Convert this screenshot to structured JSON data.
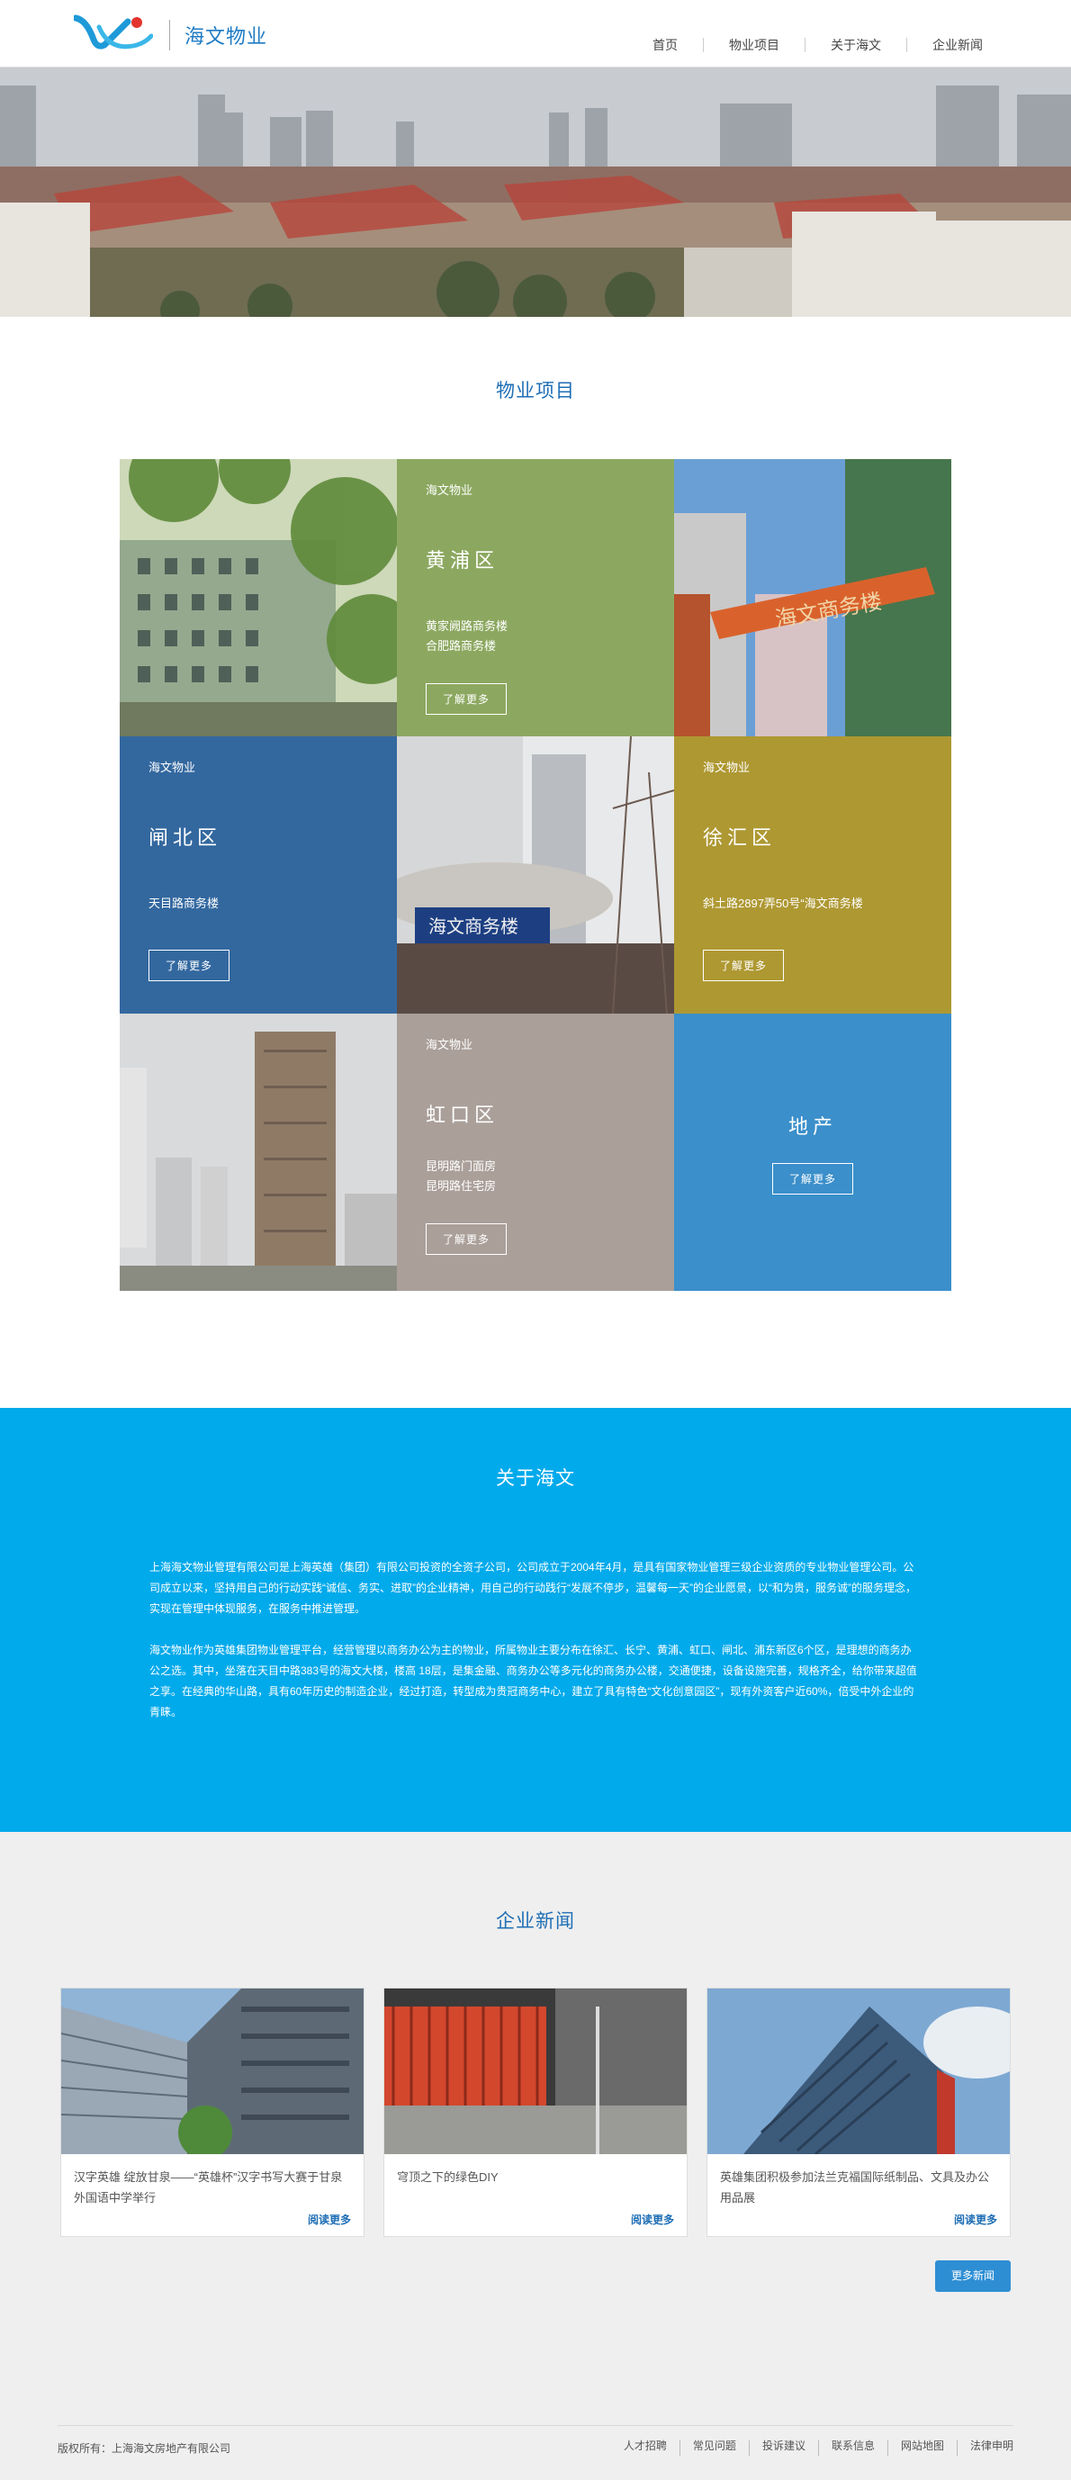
{
  "header": {
    "logo_text": "海文物业",
    "nav": [
      "首页",
      "物业项目",
      "关于海文",
      "企业新闻"
    ]
  },
  "projects": {
    "title": "物业项目",
    "tiles": {
      "huangpu": {
        "brand": "海文物业",
        "district": "黄浦区",
        "lines": [
          "黄家阙路商务楼",
          "合肥路商务楼"
        ],
        "button": "了解更多"
      },
      "zhabei": {
        "brand": "海文物业",
        "district": "闸北区",
        "lines": [
          "天目路商务楼"
        ],
        "button": "了解更多"
      },
      "xuhui": {
        "brand": "海文物业",
        "district": "徐汇区",
        "lines": [
          "斜土路2897弄50号“海文商务楼"
        ],
        "button": "了解更多"
      },
      "hongkou": {
        "brand": "海文物业",
        "district": "虹口区",
        "lines": [
          "昆明路门面房",
          "昆明路住宅房"
        ],
        "button": "了解更多"
      },
      "realestate": {
        "district": "地产",
        "button": "了解更多"
      }
    },
    "photo_signs": {
      "arch_sign": "海文商务楼",
      "building_sign": "海文商务楼"
    }
  },
  "about": {
    "title": "关于海文",
    "paragraphs": [
      "上海海文物业管理有限公司是上海英雄（集团）有限公司投资的全资子公司，公司成立于2004年4月，是具有国家物业管理三级企业资质的专业物业管理公司。公司成立以来，坚持用自己的行动实践“诚信、务实、进取”的企业精神，用自己的行动践行“发展不停步，温馨每一天”的企业愿景，以“和为贵，服务诚”的服务理念，实现在管理中体现服务，在服务中推进管理。",
      "海文物业作为英雄集团物业管理平台，经营管理以商务办公为主的物业，所属物业主要分布在徐汇、长宁、黄浦、虹口、闸北、浦东新区6个区，是理想的商务办公之选。其中，坐落在天目中路383号的海文大楼，楼高 18层，是集金融、商务办公等多元化的商务办公楼，交通便捷，设备设施完善，规格齐全，给你带来超值之享。在经典的华山路，具有60年历史的制造企业，经过打造，转型成为贵冠商务中心，建立了具有特色“文化创意园区”，现有外资客户近60%，倍受中外企业的青睐。"
    ]
  },
  "news": {
    "title": "企业新闻",
    "items": [
      {
        "title": "汉字英雄 绽放甘泉——“英雄杯”汉字书写大赛于甘泉外国语中学举行",
        "more": "阅读更多"
      },
      {
        "title": "穹顶之下的绿色DIY",
        "more": "阅读更多"
      },
      {
        "title": "英雄集团积极参加法兰克福国际纸制品、文具及办公用品展",
        "more": "阅读更多"
      }
    ],
    "more_button": "更多新闻"
  },
  "footer": {
    "copyright": "版权所有：上海海文房地产有限公司",
    "links": [
      "人才招聘",
      "常见问题",
      "投诉建议",
      "联系信息",
      "网站地图",
      "法律申明"
    ]
  },
  "colors": {
    "brand_blue": "#1e7bc4",
    "about_bg": "#00aaeb",
    "tile_green": "#8ca860",
    "tile_blue": "#33689f",
    "tile_olive": "#ae9832",
    "tile_taupe": "#aa9f99",
    "tile_sky": "#3b8fca"
  }
}
